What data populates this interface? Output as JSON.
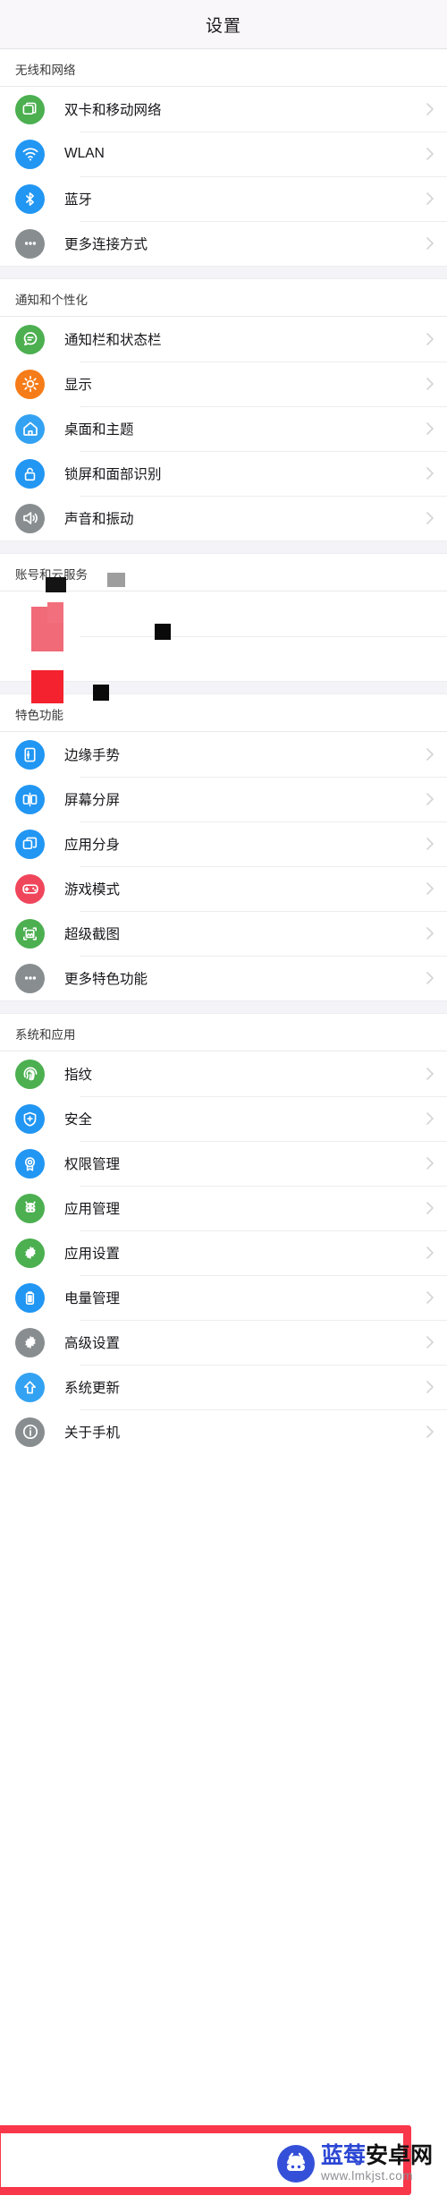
{
  "header": {
    "title": "设置"
  },
  "sections": [
    {
      "name": "无线和网络",
      "rows": [
        {
          "label": "双卡和移动网络",
          "icon": "sim-card-icon",
          "color": "#4caf50"
        },
        {
          "label": "WLAN",
          "icon": "wifi-icon",
          "color": "#2196f3"
        },
        {
          "label": "蓝牙",
          "icon": "bluetooth-icon",
          "color": "#2196f3"
        },
        {
          "label": "更多连接方式",
          "icon": "more-dots-icon",
          "color": "#888d90"
        }
      ]
    },
    {
      "name": "通知和个性化",
      "rows": [
        {
          "label": "通知栏和状态栏",
          "icon": "chat-bubble-icon",
          "color": "#4caf50"
        },
        {
          "label": "显示",
          "icon": "brightness-sun-icon",
          "color": "#f57c18"
        },
        {
          "label": "桌面和主题",
          "icon": "home-icon",
          "color": "#33a2f2"
        },
        {
          "label": "锁屏和面部识别",
          "icon": "lock-icon",
          "color": "#2196f3"
        },
        {
          "label": "声音和振动",
          "icon": "speaker-icon",
          "color": "#888d90"
        }
      ]
    },
    {
      "name": "账号和云服务",
      "redacted": true,
      "rows": [
        {
          "label": "",
          "icon": "redacted-icon",
          "color": "#f06a78"
        },
        {
          "label": "",
          "icon": "redacted-icon",
          "color": "#f4222e"
        }
      ]
    },
    {
      "name": "特色功能",
      "rows": [
        {
          "label": "边缘手势",
          "icon": "edge-gesture-icon",
          "color": "#2196f3"
        },
        {
          "label": "屏幕分屏",
          "icon": "split-screen-icon",
          "color": "#2196f3"
        },
        {
          "label": "应用分身",
          "icon": "app-clone-icon",
          "color": "#2196f3"
        },
        {
          "label": "游戏模式",
          "icon": "gamepad-icon",
          "color": "#f0465c"
        },
        {
          "label": "超级截图",
          "icon": "screenshot-icon",
          "color": "#4caf50"
        },
        {
          "label": "更多特色功能",
          "icon": "more-dots-icon",
          "color": "#888d90"
        }
      ]
    },
    {
      "name": "系统和应用",
      "rows": [
        {
          "label": "指纹",
          "icon": "fingerprint-icon",
          "color": "#4caf50"
        },
        {
          "label": "安全",
          "icon": "shield-icon",
          "color": "#2196f3"
        },
        {
          "label": "权限管理",
          "icon": "badge-icon",
          "color": "#2196f3"
        },
        {
          "label": "应用管理",
          "icon": "android-robot-icon",
          "color": "#4caf50"
        },
        {
          "label": "应用设置",
          "icon": "gear-icon",
          "color": "#4caf50"
        },
        {
          "label": "电量管理",
          "icon": "battery-icon",
          "color": "#2196f3"
        },
        {
          "label": "高级设置",
          "icon": "gear-icon",
          "color": "#888d90"
        },
        {
          "label": "系统更新",
          "icon": "arrow-up-icon",
          "color": "#33a2f2"
        },
        {
          "label": "关于手机",
          "icon": "info-icon",
          "color": "#888d90",
          "highlighted": true
        }
      ]
    }
  ],
  "watermark": {
    "name_blue": "蓝莓",
    "name_black": "安卓网",
    "url": "www.lmkjst.com"
  },
  "colors": {
    "highlight_box": "#f8384a",
    "watermark_blue": "#2b46d4",
    "page_background": "#ffffff",
    "section_gap": "#f4f4f8",
    "title_background": "#faf7fa"
  }
}
